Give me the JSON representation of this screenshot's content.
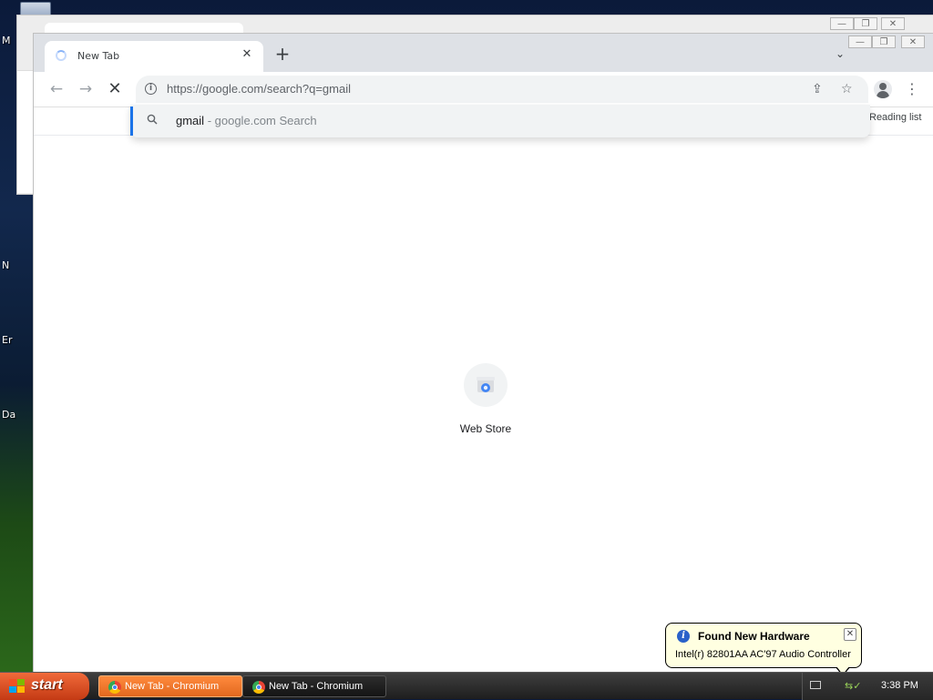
{
  "desktop": {
    "labels": [
      "M",
      "N",
      "Er",
      "Da"
    ]
  },
  "browser": {
    "tab": {
      "title": "New Tab"
    },
    "newtab_symbol": "+",
    "tab_search_symbol": "⌄",
    "omnibox": {
      "url": "https://google.com/search?q=gmail"
    },
    "suggestion": {
      "query": "gmail",
      "separator": " - ",
      "label": "google.com Search"
    },
    "bookmarks": {
      "reading_list": "Reading list"
    },
    "ntp": {
      "webstore_label": "Web Store"
    },
    "caption_buttons": [
      "—",
      "❐",
      "✕"
    ]
  },
  "taskbar": {
    "start_label": "start",
    "tasks": [
      {
        "label": "New Tab - Chromium",
        "active": true
      },
      {
        "label": "New Tab - Chromium",
        "active": false
      }
    ],
    "clock": "3:38 PM"
  },
  "balloon": {
    "title": "Found New Hardware",
    "body": "Intel(r) 82801AA AC'97 Audio Controller"
  },
  "colors": {
    "accent": "#1a73e8",
    "tabstrip": "#dee1e6",
    "omnibox_bg": "#f1f3f4",
    "start_button": "#e0562a",
    "balloon_bg": "#ffffe1"
  }
}
